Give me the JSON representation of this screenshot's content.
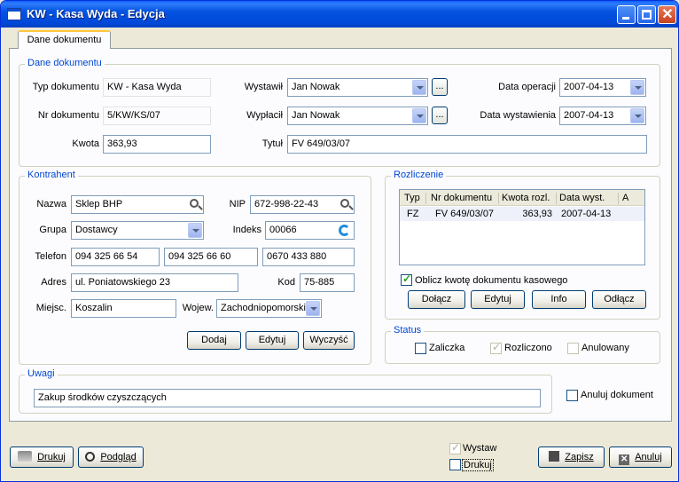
{
  "window": {
    "title": "KW - Kasa Wyda - Edycja"
  },
  "tabs": [
    {
      "label": "Dane dokumentu"
    }
  ],
  "document": {
    "group_title": "Dane dokumentu",
    "typ_label": "Typ dokumentu",
    "typ_value": "KW - Kasa Wyda",
    "nr_label": "Nr dokumentu",
    "nr_value": "5/KW/KS/07",
    "kwota_label": "Kwota",
    "kwota_value": "363,93",
    "wystawil_label": "Wystawił",
    "wystawil_value": "Jan Nowak",
    "wyplacil_label": "Wypłacił",
    "wyplacil_value": "Jan Nowak",
    "tytul_label": "Tytuł",
    "tytul_value": "FV 649/03/07",
    "data_operacji_label": "Data operacji",
    "data_operacji_value": "2007-04-13",
    "data_wystawienia_label": "Data wystawienia",
    "data_wystawienia_value": "2007-04-13",
    "dots_label": "..."
  },
  "contractor": {
    "group_title": "Kontrahent",
    "nazwa_label": "Nazwa",
    "nazwa_value": "Sklep BHP",
    "nip_label": "NIP",
    "nip_value": "672-998-22-43",
    "grupa_label": "Grupa",
    "grupa_value": "Dostawcy",
    "indeks_label": "Indeks",
    "indeks_value": "00066",
    "telefon_label": "Telefon",
    "telefon_values": [
      "094 325 66 54",
      "094 325 66 60",
      "0670 433 880"
    ],
    "adres_label": "Adres",
    "adres_value": "ul. Poniatowskiego 23",
    "kod_label": "Kod",
    "kod_value": "75-885",
    "miejsc_label": "Miejsc.",
    "miejsc_value": "Koszalin",
    "wojew_label": "Wojew.",
    "wojew_value": "Zachodniopomorskie",
    "buttons": {
      "dodaj": "Dodaj",
      "edytuj": "Edytuj",
      "wyczysc": "Wyczyść"
    }
  },
  "settlement": {
    "group_title": "Rozliczenie",
    "columns": [
      "Typ",
      "Nr dokumentu",
      "Kwota rozl.",
      "Data wyst.",
      "A"
    ],
    "rows": [
      {
        "typ": "FZ",
        "nr": "FV 649/03/07",
        "kwota": "363,93",
        "data": "2007-04-13",
        "a": ""
      }
    ],
    "calc_checkbox_label": "Oblicz kwotę dokumentu kasowego",
    "calc_checked": true,
    "buttons": {
      "dolacz": "Dołącz",
      "edytuj": "Edytuj",
      "info": "Info",
      "odlacz": "Odłącz"
    }
  },
  "status": {
    "group_title": "Status",
    "zaliczka_label": "Zaliczka",
    "zaliczka_checked": false,
    "rozliczono_label": "Rozliczono",
    "rozliczono_checked": true,
    "anulowany_label": "Anulowany",
    "anulowany_checked": false
  },
  "notes": {
    "group_title": "Uwagi",
    "value": "Zakup środków czyszczących"
  },
  "anuluj_dokument_label": "Anuluj dokument",
  "footer": {
    "drukuj_btn": "Drukuj",
    "podglad_btn": "Podgląd",
    "wystaw_label": "Wystaw",
    "wystaw_checked": true,
    "drukuj_cb_label": "Drukuj",
    "drukuj_cb_checked": false,
    "zapisz_btn": "Zapisz",
    "anuluj_btn": "Anuluj"
  }
}
